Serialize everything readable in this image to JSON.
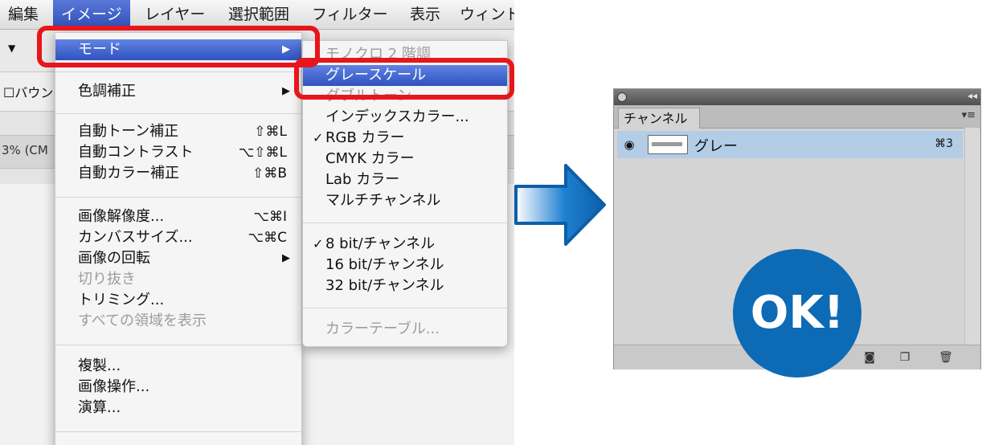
{
  "menubar": {
    "items": [
      "編集",
      "イメージ",
      "レイヤー",
      "選択範囲",
      "フィルター",
      "表示",
      "ウィンド"
    ]
  },
  "left_strip": {
    "option_label": "バウン",
    "doc_zoom": "3% (CM"
  },
  "image_menu": {
    "items": [
      {
        "label": "モード",
        "shortcut": ""
      },
      {
        "label": "色調補正",
        "shortcut": ""
      },
      {
        "label": "自動トーン補正",
        "shortcut": "⇧⌘L"
      },
      {
        "label": "自動コントラスト",
        "shortcut": "⌥⇧⌘L"
      },
      {
        "label": "自動カラー補正",
        "shortcut": "⇧⌘B"
      },
      {
        "label": "画像解像度...",
        "shortcut": "⌥⌘I"
      },
      {
        "label": "カンバスサイズ...",
        "shortcut": "⌥⌘C"
      },
      {
        "label": "画像の回転",
        "shortcut": ""
      },
      {
        "label": "切り抜き",
        "shortcut": ""
      },
      {
        "label": "トリミング...",
        "shortcut": ""
      },
      {
        "label": "すべての領域を表示",
        "shortcut": ""
      },
      {
        "label": "複製...",
        "shortcut": ""
      },
      {
        "label": "画像操作...",
        "shortcut": ""
      },
      {
        "label": "演算...",
        "shortcut": ""
      }
    ]
  },
  "mode_submenu": {
    "items": [
      {
        "label": "モノクロ 2 階調"
      },
      {
        "label": "グレースケール"
      },
      {
        "label": "ダブルトーン"
      },
      {
        "label": "インデックスカラー..."
      },
      {
        "label": "RGB カラー"
      },
      {
        "label": "CMYK カラー"
      },
      {
        "label": "Lab カラー"
      },
      {
        "label": "マルチチャンネル"
      },
      {
        "label": "8 bit/チャンネル"
      },
      {
        "label": "16 bit/チャンネル"
      },
      {
        "label": "32 bit/チャンネル"
      },
      {
        "label": "カラーテーブル..."
      }
    ],
    "checkmark": "✓"
  },
  "channels_panel": {
    "tab_label": "チャンネル",
    "channel": {
      "name": "グレー",
      "shortcut": "⌘3"
    }
  },
  "badge": {
    "text": "OK!"
  },
  "icons": {
    "submenu_arrow": "submenu-arrow-icon",
    "eye": "eye-icon",
    "arrow": "right-arrow-icon",
    "save_selection": "save-selection-icon",
    "new_channel": "new-channel-icon",
    "trash": "trash-icon"
  },
  "colors": {
    "highlight_blue": "#2f52bf",
    "red_outline": "#e8151b",
    "badge_blue": "#0d6ab5",
    "channel_row_selected": "#b3cde6"
  }
}
